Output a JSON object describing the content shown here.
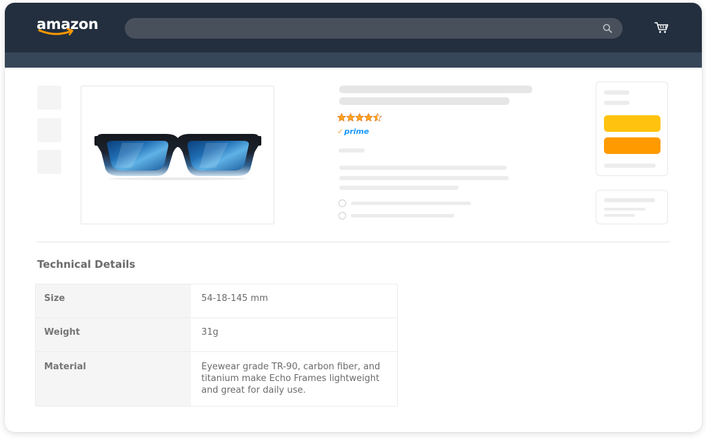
{
  "header": {
    "logo_text": "amazon",
    "search": {
      "placeholder": ""
    }
  },
  "product": {
    "image": "blue-mirrored-sunglasses",
    "rating_stars": 4.5,
    "badge": "prime"
  },
  "details": {
    "title": "Technical Details",
    "rows": [
      {
        "label": "Size",
        "value": "54-18-145 mm"
      },
      {
        "label": "Weight",
        "value": "31g"
      },
      {
        "label": "Material",
        "value": "Eyewear grade TR-90, carbon fiber, and titanium make Echo Frames lightweight and great for daily use."
      }
    ]
  },
  "colors": {
    "header_bg": "#232f3e",
    "subnav_bg": "#37475a",
    "add_to_cart": "#ffc20e",
    "buy_now": "#ff9a00",
    "star": "#ffa41c",
    "prime": "#1a98ff"
  },
  "icons": {
    "search": "search-icon",
    "cart": "cart-icon",
    "star": "star-icon"
  }
}
